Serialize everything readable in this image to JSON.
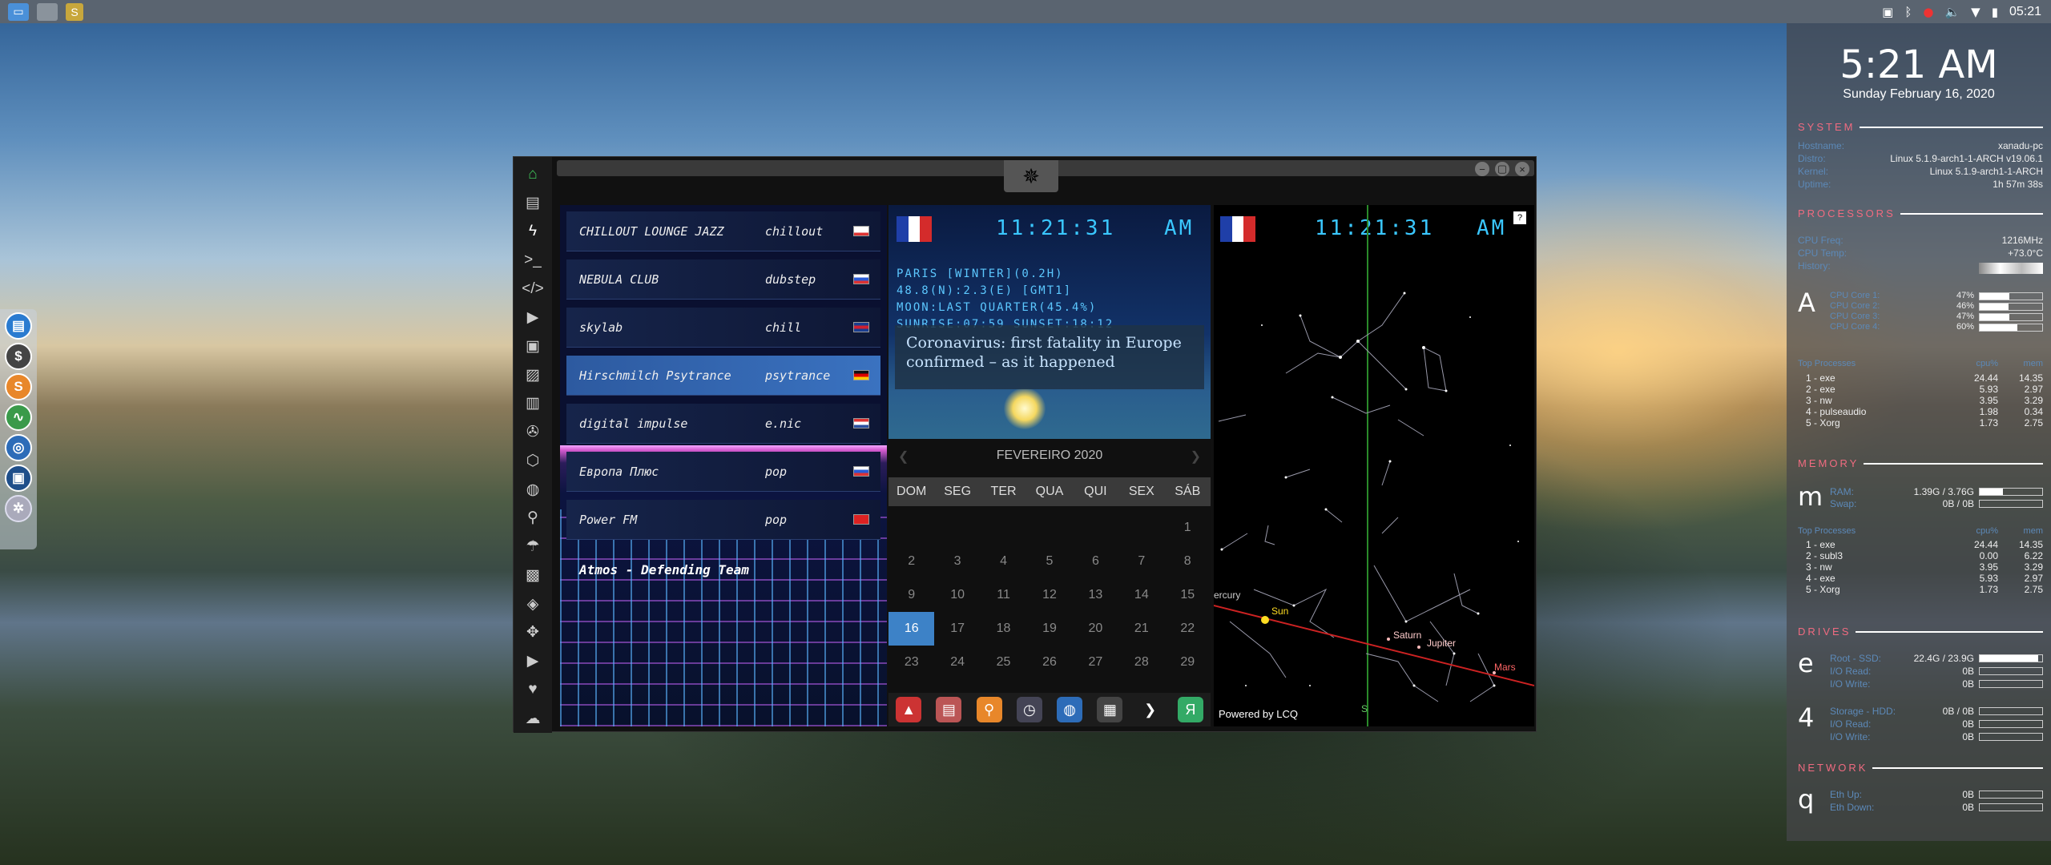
{
  "taskbar": {
    "apps": [
      "file-manager-icon",
      "window-icon",
      "sublime-icon"
    ],
    "tray_icons": [
      "screenshot-icon",
      "bluetooth-icon",
      "record-icon",
      "volume-icon",
      "wifi-icon",
      "battery-icon"
    ],
    "clock": "05:21"
  },
  "dock": {
    "items": [
      "finder-icon",
      "money-icon",
      "sublime-text-icon",
      "monitor-icon",
      "chrome-icon",
      "screen-icon",
      "settings-icon"
    ]
  },
  "conky": {
    "time": "5:21 AM",
    "date": "Sunday February 16, 2020",
    "system_title": "SYSTEM",
    "system": [
      {
        "k": "Hostname:",
        "v": "xanadu-pc"
      },
      {
        "k": "Distro:",
        "v": "Linux 5.1.9-arch1-1-ARCH v19.06.1"
      },
      {
        "k": "Kernel:",
        "v": "Linux 5.1.9-arch1-1-ARCH"
      },
      {
        "k": "Uptime:",
        "v": "1h 57m 38s"
      }
    ],
    "processors_title": "PROCESSORS",
    "cpu_info": [
      {
        "k": "CPU Freq:",
        "v": "1216MHz"
      },
      {
        "k": "CPU Temp:",
        "v": "+73.0°C"
      },
      {
        "k": "History:",
        "v": ""
      }
    ],
    "cpu_letter": "A",
    "cores": [
      {
        "k": "CPU Core 1:",
        "v": "47%",
        "level": 0.47
      },
      {
        "k": "CPU Core 2:",
        "v": "46%",
        "level": 0.46
      },
      {
        "k": "CPU Core 3:",
        "v": "47%",
        "level": 0.47
      },
      {
        "k": "CPU Core 4:",
        "v": "60%",
        "level": 0.6
      }
    ],
    "top_cpu_title": "Top Processes",
    "top_cpu_h1": "cpu%",
    "top_cpu_h2": "mem",
    "top_cpu": [
      {
        "n": "1 - exe",
        "a": "24.44",
        "b": "14.35"
      },
      {
        "n": "2 - exe",
        "a": "5.93",
        "b": "2.97"
      },
      {
        "n": "3 - nw",
        "a": "3.95",
        "b": "3.29"
      },
      {
        "n": "4 - pulseaudio",
        "a": "1.98",
        "b": "0.34"
      },
      {
        "n": "5 - Xorg",
        "a": "1.73",
        "b": "2.75"
      }
    ],
    "memory_title": "MEMORY",
    "mem_letter": "m",
    "memory": [
      {
        "k": "RAM:",
        "v": "1.39G / 3.76G",
        "level": 0.37
      },
      {
        "k": "Swap:",
        "v": "0B / 0B",
        "level": 0
      }
    ],
    "top_mem_title": "Top Processes",
    "top_mem_h1": "cpu%",
    "top_mem_h2": "mem",
    "top_mem": [
      {
        "n": "1 - exe",
        "a": "24.44",
        "b": "14.35"
      },
      {
        "n": "2 - subl3",
        "a": "0.00",
        "b": "6.22"
      },
      {
        "n": "3 - nw",
        "a": "3.95",
        "b": "3.29"
      },
      {
        "n": "4 - exe",
        "a": "5.93",
        "b": "2.97"
      },
      {
        "n": "5 - Xorg",
        "a": "1.73",
        "b": "2.75"
      }
    ],
    "drives_title": "DRIVES",
    "drive1_letter": "e",
    "drive1": [
      {
        "k": "Root - SSD:",
        "v": "22.4G / 23.9G",
        "level": 0.94
      },
      {
        "k": "I/O Read:",
        "v": "0B",
        "level": 0
      },
      {
        "k": "I/O Write:",
        "v": "0B",
        "level": 0
      }
    ],
    "drive2_letter": "4",
    "drive2": [
      {
        "k": "Storage - HDD:",
        "v": "0B / 0B",
        "level": 0
      },
      {
        "k": "I/O Read:",
        "v": "0B",
        "level": 0
      },
      {
        "k": "I/O Write:",
        "v": "0B",
        "level": 0
      }
    ],
    "network_title": "NETWORK",
    "net_letter": "q",
    "network": [
      {
        "k": "Eth Up:",
        "v": "0B",
        "level": 0
      },
      {
        "k": "Eth Down:",
        "v": "0B",
        "level": 0
      }
    ]
  },
  "window": {
    "sidebar_icons": [
      "home-icon",
      "document-icon",
      "lightning-icon",
      "terminal-icon",
      "code-icon",
      "play-icon",
      "files-icon",
      "image-icon",
      "news-icon",
      "aperture-icon",
      "hexagon-icon",
      "globe-icon",
      "search-icon",
      "umbrella-icon",
      "contact-icon",
      "stack-icon",
      "fullscreen-icon",
      "youtube-icon",
      "heart-icon",
      "cloud-icon"
    ],
    "controls": [
      "−",
      "▢",
      "×"
    ]
  },
  "radio": {
    "stations": [
      {
        "name": "CHILLOUT LOUNGE JAZZ",
        "genre": "chillout",
        "flag": [
          "#fff",
          "#fff",
          "#d33"
        ],
        "selected": false
      },
      {
        "name": "NEBULA CLUB",
        "genre": "dubstep",
        "flag": [
          "#fff",
          "#2a5bd6",
          "#d33"
        ],
        "selected": false
      },
      {
        "name": "skylab",
        "genre": "chill",
        "flag": [
          "#1b3d8f",
          "#cf2030",
          "#1b3d8f"
        ],
        "selected": false
      },
      {
        "name": "Hirschmilch Psytrance",
        "genre": "psytrance",
        "flag": [
          "#111",
          "#d00",
          "#fc0"
        ],
        "selected": true
      },
      {
        "name": "digital impulse",
        "genre": "e.nic",
        "flag": [
          "#d33",
          "#fff",
          "#2a4fa0"
        ],
        "selected": false
      },
      {
        "name": "Европа Плюс",
        "genre": "pop",
        "flag": [
          "#fff",
          "#2a5bd6",
          "#d33"
        ],
        "selected": false
      },
      {
        "name": "Power FM",
        "genre": "pop",
        "flag": [
          "#d22",
          "#d22",
          "#d22"
        ],
        "selected": false
      }
    ],
    "now_playing": "Atmos - Defending Team"
  },
  "clock": {
    "digits": "11:21:31",
    "ampm": "AM",
    "info": "PARIS [WINTER](0.2H)\n48.8(N):2.3(E) [GMT1]\nMOON:LAST QUARTER(45.4%)\nSUNRISE:07:59 SUNSET:18:12",
    "headline": "Coronavirus: first fatality in Europe confirmed – as it happened"
  },
  "calendar": {
    "month": "FEVEREIRO 2020",
    "prev": "❮",
    "next": "❯",
    "weekdays": [
      "DOM",
      "SEG",
      "TER",
      "QUA",
      "QUI",
      "SEX",
      "SÁB"
    ],
    "weeks": [
      [
        "",
        "",
        "",
        "",
        "",
        "",
        "1"
      ],
      [
        "2",
        "3",
        "4",
        "5",
        "6",
        "7",
        "8"
      ],
      [
        "9",
        "10",
        "11",
        "12",
        "13",
        "14",
        "15"
      ],
      [
        "16",
        "17",
        "18",
        "19",
        "20",
        "21",
        "22"
      ],
      [
        "23",
        "24",
        "25",
        "26",
        "27",
        "28",
        "29"
      ]
    ],
    "today": "16",
    "launchers": [
      {
        "icon": "▲",
        "name": "launcher-red-icon",
        "color": "#c33"
      },
      {
        "icon": "▤",
        "name": "launcher-news-icon",
        "color": "#b55"
      },
      {
        "icon": "⚲",
        "name": "launcher-search-icon",
        "color": "#e8872a"
      },
      {
        "icon": "◷",
        "name": "launcher-clock-icon",
        "color": "#445"
      },
      {
        "icon": "◍",
        "name": "launcher-globe-icon",
        "color": "#2d6cb8"
      },
      {
        "icon": "▦",
        "name": "launcher-calendar-icon",
        "color": "#444"
      },
      {
        "icon": "❯",
        "name": "launcher-arrow-icon",
        "color": "#1c1c1c"
      },
      {
        "icon": "Я",
        "name": "launcher-circle-icon",
        "color": "#3a6"
      }
    ]
  },
  "starmap": {
    "help": "?",
    "powered": "Powered by LCQ",
    "planets": {
      "mercury": "ercury",
      "sun": "Sun",
      "saturn": "Saturn",
      "jupiter": "Jupiter",
      "mars": "Mars",
      "s": "S"
    }
  }
}
